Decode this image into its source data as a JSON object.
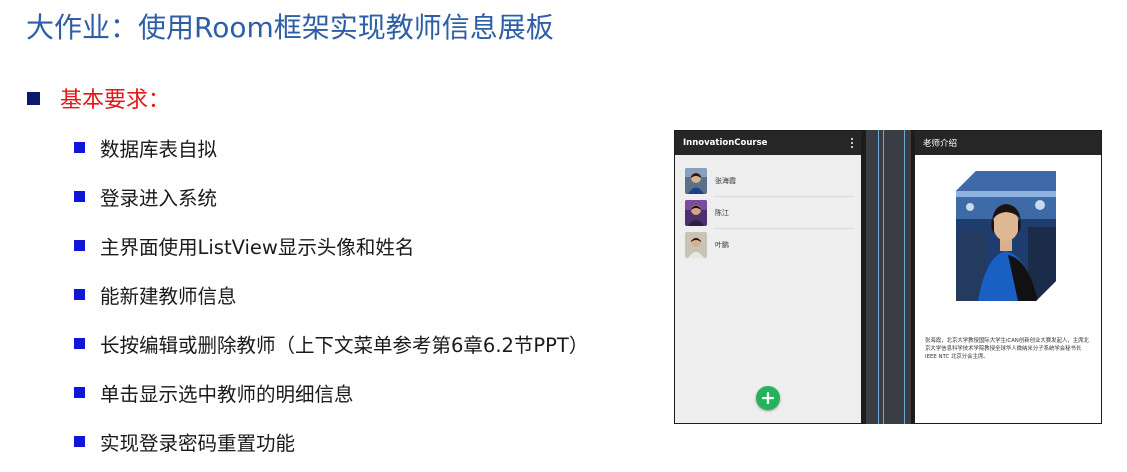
{
  "slide": {
    "title": "大作业：使用Room框架实现教师信息展板",
    "section_label": "基本要求：",
    "bullets": [
      "数据库表自拟",
      "登录进入系统",
      "主界面使用ListView显示头像和姓名",
      "能新建教师信息",
      "长按编辑或删除教师（上下文菜单参考第6章6.2节PPT）",
      "单击显示选中教师的明细信息",
      "实现登录密码重置功能"
    ]
  },
  "phone_list": {
    "app_title": "InnovationCourse",
    "overflow_icon": "more-vert-icon",
    "items": [
      {
        "name": "张海霞"
      },
      {
        "name": "陈江"
      },
      {
        "name": "叶鹏"
      }
    ],
    "fab_label": "+"
  },
  "phone_detail": {
    "app_title": "老师介绍",
    "bio": "张海霞，北京大学教授国际大学生iCAN创新创业大赛发起人，主席北京大学信息科学技术学院教授全球华人微纳米分子系统学会秘书长IEEE NTC 北京分会主席。"
  },
  "colors": {
    "title": "#2e5fa6",
    "section": "#e51616",
    "section_bullet": "#0a1870",
    "item_bullet": "#0f16d8",
    "fab": "#22b35c"
  }
}
